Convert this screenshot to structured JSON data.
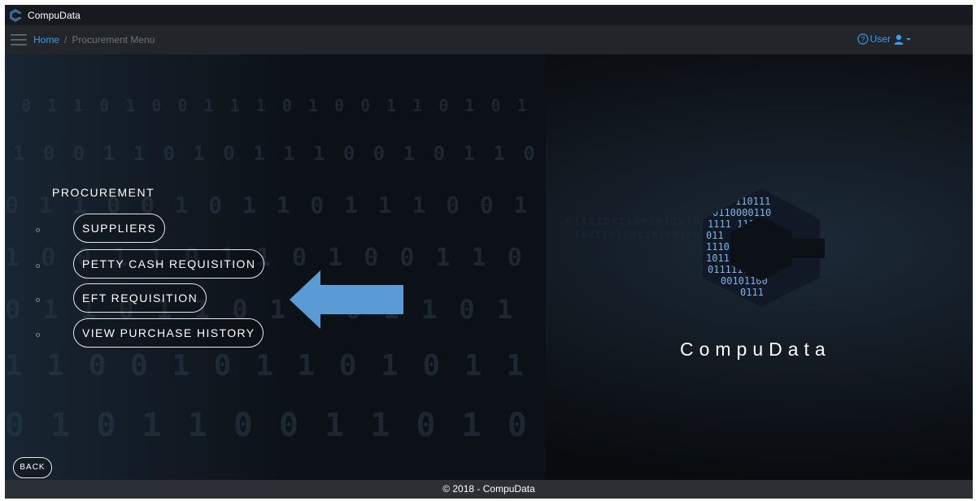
{
  "app": {
    "title": "CompuData"
  },
  "nav": {
    "breadcrumb": {
      "home": "Home",
      "separator": "/",
      "current": "Procurement Menu"
    },
    "user_label": "User"
  },
  "main": {
    "section_title": "PROCUREMENT",
    "menu_items": [
      {
        "label": "SUPPLIERS"
      },
      {
        "label": "PETTY CASH REQUISITION"
      },
      {
        "label": "EFT REQUISITION"
      },
      {
        "label": "VIEW PURCHASE HISTORY"
      }
    ],
    "annotation": "arrow-left pointing at EFT REQUISITION",
    "back_label": "BACK"
  },
  "brand": {
    "name": "CompuData",
    "logo_binary": [
      "110111",
      "0110000110",
      "1111   1110",
      "0110",
      "1110",
      "1011   0101",
      "011111100101",
      "001011001",
      "0111"
    ]
  },
  "footer": {
    "text": "© 2018 - CompuData"
  },
  "colors": {
    "accent": "#3f9be6",
    "arrow": "#5b9bd5",
    "background": "#0b0d10"
  }
}
